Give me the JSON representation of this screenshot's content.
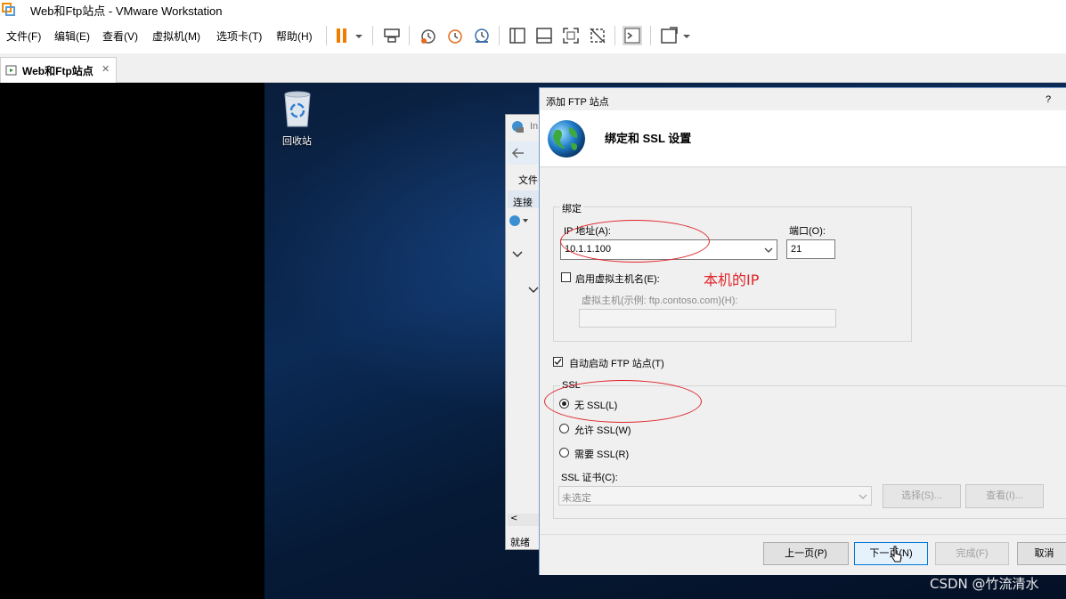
{
  "window": {
    "title": "Web和Ftp站点 - VMware Workstation"
  },
  "menus": [
    "文件(F)",
    "编辑(E)",
    "查看(V)",
    "虚拟机(M)",
    "选项卡(T)",
    "帮助(H)"
  ],
  "toolbar_icons": [
    "pause-icon",
    "dropdown-icon",
    "send-keys-icon",
    "snapshot-icon",
    "revert-snapshot-icon",
    "manage-snapshots-icon",
    "view-sidebar-icon",
    "view-thumbnail-icon",
    "fullscreen-icon",
    "unity-icon",
    "console-icon",
    "stretch-icon",
    "dropdown-icon"
  ],
  "tab": {
    "label": "Web和Ftp站点",
    "close": "✕"
  },
  "desktop": {
    "recycle_bin_label": "回收站"
  },
  "iis": {
    "title_partial": "In",
    "menu_file": "文件",
    "connections": "连接",
    "status": "就绪"
  },
  "dialog": {
    "title": "添加 FTP 站点",
    "help": "?",
    "heading": "绑定和 SSL 设置",
    "binding_group": "绑定",
    "ip_label": "IP 地址(A):",
    "ip_value": "10.1.1.100",
    "port_label": "端口(O):",
    "port_value": "21",
    "virtual_host_enable": "启用虚拟主机名(E):",
    "virtual_host_hint": "虚拟主机(示例: ftp.contoso.com)(H):",
    "virtual_host_value": "",
    "autostart_label": "自动启动 FTP 站点(T)",
    "ssl_group": "SSL",
    "ssl_options": [
      "无 SSL(L)",
      "允许 SSL(W)",
      "需要 SSL(R)"
    ],
    "ssl_selected": "无 SSL(L)",
    "cert_label": "SSL 证书(C):",
    "cert_value": "未选定",
    "select_button": "选择(S)...",
    "view_button": "查看(I)...",
    "prev_button": "上一页(P)",
    "next_button": "下一页(N)",
    "finish_button": "完成(F)",
    "cancel_button": "取消"
  },
  "annotation": {
    "text": "本机的IP",
    "color": "#e0252a"
  },
  "watermark": "CSDN @竹流清水"
}
